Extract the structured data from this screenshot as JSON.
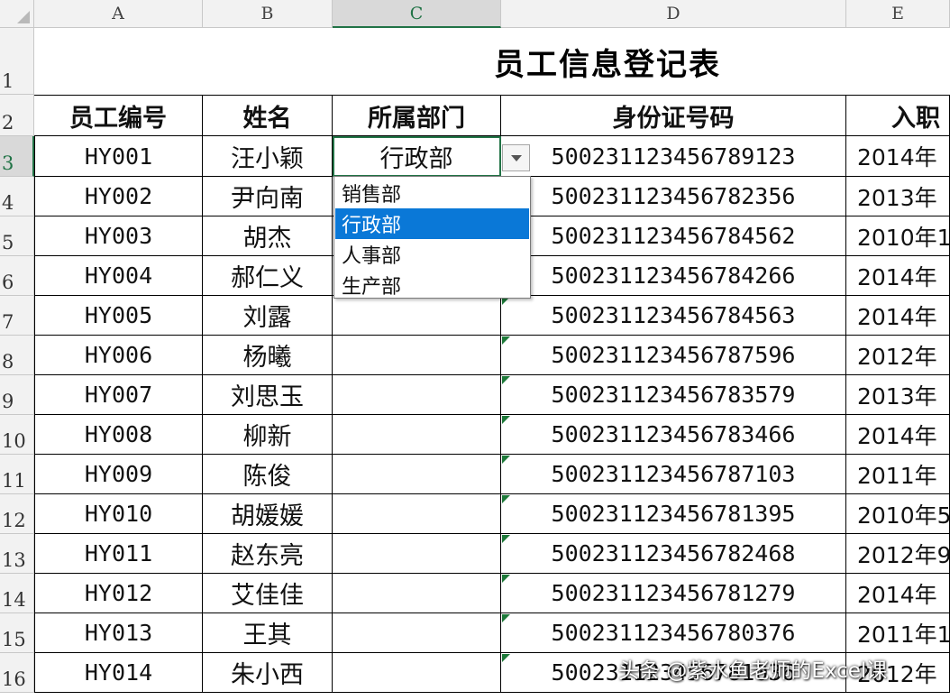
{
  "columns": [
    "A",
    "B",
    "C",
    "D",
    "E"
  ],
  "row_numbers": [
    "1",
    "2",
    "3",
    "4",
    "5",
    "6",
    "7",
    "8",
    "9",
    "10",
    "11",
    "12",
    "13",
    "14",
    "15",
    "16"
  ],
  "title": "员工信息登记表",
  "headers": [
    "员工编号",
    "姓名",
    "所属部门",
    "身份证号码",
    "入职"
  ],
  "rows": [
    {
      "id": "HY001",
      "name": "汪小颖",
      "dept": "行政部",
      "idcard": "500231123456789123",
      "date": "2014年"
    },
    {
      "id": "HY002",
      "name": "尹向南",
      "dept": "",
      "idcard": "500231123456782356",
      "date": "2013年"
    },
    {
      "id": "HY003",
      "name": "胡杰",
      "dept": "",
      "idcard": "500231123456784562",
      "date": "2010年1"
    },
    {
      "id": "HY004",
      "name": "郝仁义",
      "dept": "",
      "idcard": "500231123456784266",
      "date": "2014年"
    },
    {
      "id": "HY005",
      "name": "刘露",
      "dept": "",
      "idcard": "500231123456784563",
      "date": "2014年"
    },
    {
      "id": "HY006",
      "name": "杨曦",
      "dept": "",
      "idcard": "500231123456787596",
      "date": "2012年"
    },
    {
      "id": "HY007",
      "name": "刘思玉",
      "dept": "",
      "idcard": "500231123456783579",
      "date": "2013年"
    },
    {
      "id": "HY008",
      "name": "柳新",
      "dept": "",
      "idcard": "500231123456783466",
      "date": "2014年"
    },
    {
      "id": "HY009",
      "name": "陈俊",
      "dept": "",
      "idcard": "500231123456787103",
      "date": "2011年"
    },
    {
      "id": "HY010",
      "name": "胡媛媛",
      "dept": "",
      "idcard": "500231123456781395",
      "date": "2010年5"
    },
    {
      "id": "HY011",
      "name": "赵东亮",
      "dept": "",
      "idcard": "500231123456782468",
      "date": "2012年9"
    },
    {
      "id": "HY012",
      "name": "艾佳佳",
      "dept": "",
      "idcard": "500231123456781279",
      "date": "2014年"
    },
    {
      "id": "HY013",
      "name": "王其",
      "dept": "",
      "idcard": "500231123456780376",
      "date": "2011年1"
    },
    {
      "id": "HY014",
      "name": "朱小西",
      "dept": "",
      "idcard": "500231123456781036",
      "date": "2012年"
    }
  ],
  "dropdown": {
    "options": [
      "销售部",
      "行政部",
      "人事部",
      "生产部"
    ],
    "highlighted_index": 1
  },
  "watermark": "头条 @紫水鱼老师的Excel课",
  "colors": {
    "selection": "#217346",
    "highlight": "#0a78d7",
    "error_triangle": "#1e7a3a"
  }
}
